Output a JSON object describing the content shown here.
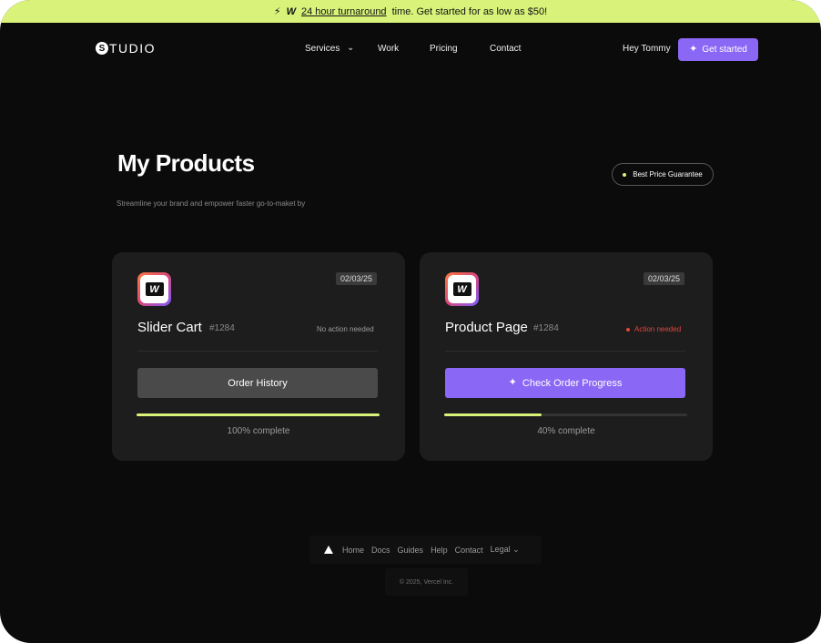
{
  "announcement": {
    "bolt_icon": "bolt-icon",
    "logo_icon": "webflow-icon",
    "link_text": "24 hour turnaround",
    "rest_text": "time. Get started for as low as $50!",
    "background": "#d9f37a"
  },
  "nav": {
    "brand_initial": "S",
    "brand_text": "TUDIO",
    "items": [
      "Services",
      "Work",
      "Pricing",
      "Contact"
    ],
    "greeting": "Hey Tommy",
    "cta_label": "Get started",
    "accent": "#8b67f5"
  },
  "page": {
    "title": "My Products",
    "subtitle": "Streamline your brand and empower faster go-to-maket by",
    "badge": "Best Price Guarantee"
  },
  "products": [
    {
      "date": "02/03/25",
      "name": "Slider Cart",
      "id": "#1284",
      "status": "No action needed",
      "action_label": "Order History",
      "progress": 1.0,
      "progress_label": "100% complete"
    },
    {
      "date": "02/03/25",
      "name": "Product Page",
      "id": "#1284",
      "status": "Action needed",
      "action_label": "Check Order Progress",
      "progress": 0.4,
      "progress_label": "40% complete"
    }
  ],
  "footer": {
    "links": [
      "Home",
      "Docs",
      "Guides",
      "Help",
      "Contact",
      "Legal"
    ],
    "copyright": "© 2025, Vercel Inc."
  }
}
